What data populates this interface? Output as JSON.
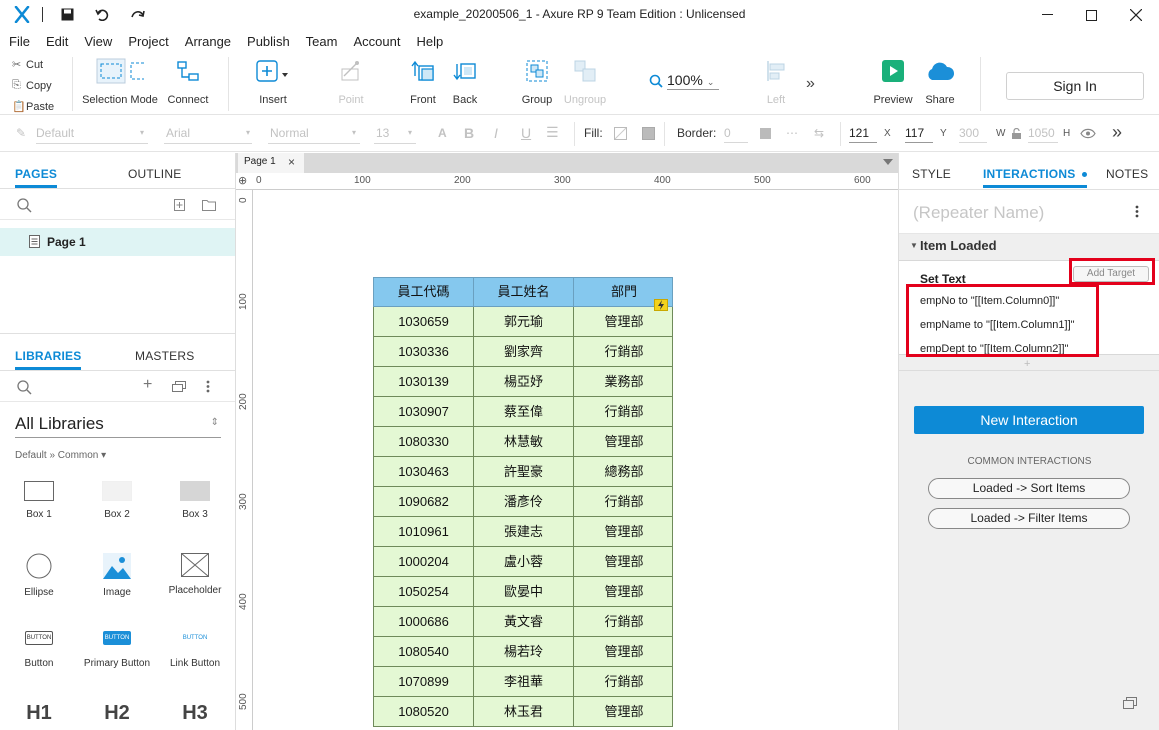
{
  "window": {
    "title": "example_20200506_1 - Axure RP 9 Team Edition : Unlicensed"
  },
  "menu": [
    "File",
    "Edit",
    "View",
    "Project",
    "Arrange",
    "Publish",
    "Team",
    "Account",
    "Help"
  ],
  "clipboard": {
    "cut": "Cut",
    "copy": "Copy",
    "paste": "Paste"
  },
  "toolbar": {
    "selection_mode": "Selection Mode",
    "connect": "Connect",
    "insert": "Insert",
    "point": "Point",
    "front": "Front",
    "back": "Back",
    "group": "Group",
    "ungroup": "Ungroup",
    "zoom": "100%",
    "left": "Left",
    "preview": "Preview",
    "share": "Share",
    "sign_in": "Sign In"
  },
  "format": {
    "style": "Default",
    "font": "Arial",
    "weight": "Normal",
    "size": "13",
    "fill_label": "Fill:",
    "border_label": "Border:",
    "border_value": "0",
    "x": "121",
    "x_label": "X",
    "y": "117",
    "y_label": "Y",
    "w": "300",
    "w_label": "W",
    "h": "1050",
    "h_label": "H"
  },
  "left": {
    "tabs": {
      "pages": "PAGES",
      "outline": "OUTLINE"
    },
    "pages": [
      {
        "label": "Page 1"
      }
    ],
    "lib_tabs": {
      "libraries": "LIBRARIES",
      "masters": "MASTERS"
    },
    "library_select": "All Libraries",
    "breadcrumb": "Default » Common ▾",
    "widgets": [
      {
        "label": "Box 1"
      },
      {
        "label": "Box 2"
      },
      {
        "label": "Box 3"
      },
      {
        "label": "Ellipse"
      },
      {
        "label": "Image"
      },
      {
        "label": "Placeholder"
      },
      {
        "label": "Button"
      },
      {
        "label": "Primary Button"
      },
      {
        "label": "Link Button"
      },
      {
        "label": "H1"
      },
      {
        "label": "H2"
      },
      {
        "label": "H3"
      }
    ],
    "button_thumb": "BUTTON"
  },
  "canvas": {
    "page_tab": "Page 1",
    "ruler_top": [
      "0",
      "100",
      "200",
      "300",
      "400",
      "500",
      "600"
    ],
    "ruler_left": [
      "0",
      "100",
      "200",
      "300",
      "400",
      "500"
    ],
    "table": {
      "headers": [
        "員工代碼",
        "員工姓名",
        "部門"
      ],
      "rows": [
        [
          "1030659",
          "郭元瑜",
          "管理部"
        ],
        [
          "1030336",
          "劉家齊",
          "行銷部"
        ],
        [
          "1030139",
          "楊亞妤",
          "業務部"
        ],
        [
          "1030907",
          "蔡至偉",
          "行銷部"
        ],
        [
          "1080330",
          "林慧敏",
          "管理部"
        ],
        [
          "1030463",
          "許聖豪",
          "總務部"
        ],
        [
          "1090682",
          "潘彥伶",
          "行銷部"
        ],
        [
          "1010961",
          "張建志",
          "管理部"
        ],
        [
          "1000204",
          "盧小蓉",
          "管理部"
        ],
        [
          "1050254",
          "歐晏中",
          "管理部"
        ],
        [
          "1000686",
          "黃文睿",
          "行銷部"
        ],
        [
          "1080540",
          "楊若玲",
          "管理部"
        ],
        [
          "1070899",
          "李祖華",
          "行銷部"
        ],
        [
          "1080520",
          "林玉君",
          "管理部"
        ]
      ]
    }
  },
  "right": {
    "tabs": {
      "style": "STYLE",
      "interactions": "INTERACTIONS",
      "notes": "NOTES"
    },
    "repeater_name_placeholder": "(Repeater Name)",
    "event": "Item Loaded",
    "action": "Set Text",
    "add_target": "Add Target",
    "assignments": [
      "empNo to \"[[Item.Column0]]\"",
      "empName to \"[[Item.Column1]]\"",
      "empDept to \"[[Item.Column2]]\""
    ],
    "new_interaction": "New Interaction",
    "common_title": "COMMON INTERACTIONS",
    "common": [
      "Loaded -> Sort Items",
      "Loaded -> Filter Items"
    ]
  },
  "colors": {
    "accent": "#0d8ad6",
    "highlight": "#e3001b",
    "header": "#85c8ee",
    "row": "#e4f8d4"
  }
}
